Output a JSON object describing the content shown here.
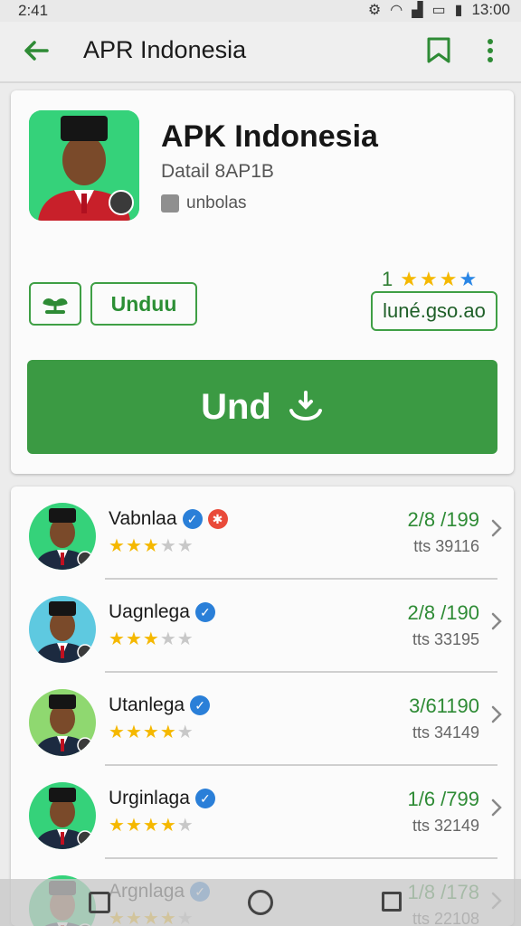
{
  "status_bar": {
    "time_left": "2:41",
    "time_right": "13:00"
  },
  "app_bar": {
    "title": "APR Indonesia"
  },
  "app": {
    "name": "APK Indonesia",
    "subtitle": "Datail 8AP1B",
    "developer": "unbolas",
    "pill_label": "Unduu",
    "rating_count": "1",
    "domain": "luné.gso.ao",
    "download_label": "Und"
  },
  "colors": {
    "accent": "#3b9a43",
    "verify": "#2a7fd8",
    "star": "#f5b800"
  },
  "list": [
    {
      "name": "Vabnlaa",
      "date": "2/8 /199",
      "size": "tts 39116",
      "rating": 2.5,
      "badge": "red",
      "avatar_bg": "#35d27a"
    },
    {
      "name": "Uagnlega",
      "date": "2/8 /190",
      "size": "tts 33195",
      "rating": 2.5,
      "badge": "",
      "avatar_bg": "#5ec9e0"
    },
    {
      "name": "Utanlega",
      "date": "3/61190",
      "size": "tts 34149",
      "rating": 4,
      "badge": "",
      "avatar_bg": "#8fd870"
    },
    {
      "name": "Urginlaga",
      "date": "1/6 /799",
      "size": "tts 32149",
      "rating": 4,
      "badge": "",
      "avatar_bg": "#35d27a"
    },
    {
      "name": "Argnlaga",
      "date": "1/8 /178",
      "size": "tts 22108",
      "rating": 4,
      "badge": "",
      "avatar_bg": "#35d27a"
    }
  ]
}
